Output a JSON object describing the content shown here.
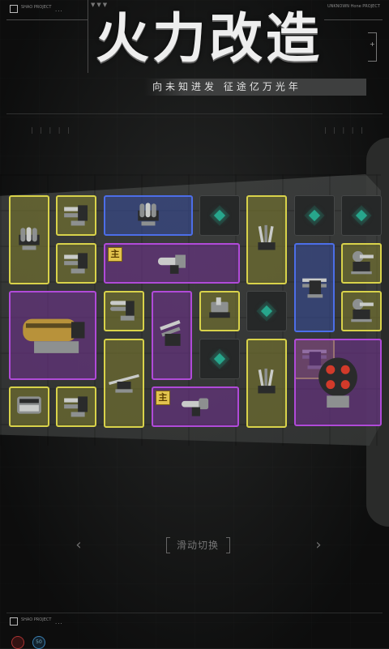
{
  "header": {
    "title": "火力改造",
    "subtitle": "向未知进发  征途亿万光年",
    "hud_tag_left": "!",
    "hud_tiny_left": "SHAO PROJECT",
    "hud_dots": "...",
    "hud_tiny_right": "UNKNOWN Hone PROJECT",
    "hud_plus": "+"
  },
  "deco": {
    "ticks_left": "|  |  |  |  |",
    "ticks_right": "|  |  |  |  |"
  },
  "grid": {
    "main_badge": "主",
    "slots": [
      {
        "name": "slot-rocket-pod",
        "color": "yellow",
        "weapon": "rocket-pod-icon"
      },
      {
        "name": "slot-twin-cannon-a",
        "color": "yellow",
        "weapon": "twin-cannon-icon"
      },
      {
        "name": "slot-rocket-pod-blue",
        "color": "blue",
        "weapon": "rocket-pod-icon"
      },
      {
        "name": "slot-empty-1",
        "color": "empty",
        "weapon": ""
      },
      {
        "name": "slot-missile-rack-a",
        "color": "yellow",
        "weapon": "missile-rack-icon"
      },
      {
        "name": "slot-empty-2",
        "color": "empty",
        "weapon": ""
      },
      {
        "name": "slot-empty-3",
        "color": "empty",
        "weapon": ""
      },
      {
        "name": "slot-twin-cannon-b",
        "color": "yellow",
        "weapon": "twin-cannon-icon"
      },
      {
        "name": "slot-main-gatling",
        "color": "purple",
        "weapon": "gatling-cannon-icon",
        "main": true
      },
      {
        "name": "slot-twin-turret-blue",
        "color": "blue",
        "weapon": "twin-turret-icon"
      },
      {
        "name": "slot-heavy-turret-a",
        "color": "yellow",
        "weapon": "heavy-turret-icon"
      },
      {
        "name": "slot-heavy-cannon",
        "color": "purple",
        "weapon": "heavy-cannon-icon"
      },
      {
        "name": "slot-twin-barrel",
        "color": "yellow",
        "weapon": "twin-barrel-icon"
      },
      {
        "name": "slot-artillery",
        "color": "purple",
        "weapon": "artillery-icon"
      },
      {
        "name": "slot-mortar",
        "color": "yellow",
        "weapon": "mortar-icon"
      },
      {
        "name": "slot-empty-4",
        "color": "empty",
        "weapon": ""
      },
      {
        "name": "slot-heavy-turret-b",
        "color": "yellow",
        "weapon": "heavy-turret-icon"
      },
      {
        "name": "slot-empty-5",
        "color": "empty",
        "weapon": ""
      },
      {
        "name": "slot-missile-rack-b",
        "color": "yellow",
        "weapon": "missile-rack-icon"
      },
      {
        "name": "slot-long-rifle",
        "color": "yellow",
        "weapon": "long-rifle-icon"
      },
      {
        "name": "slot-twin-turret-c",
        "color": "yellow",
        "weapon": "twin-turret-icon"
      },
      {
        "name": "slot-rotary-launcher",
        "color": "purple",
        "weapon": "rotary-launcher-icon"
      },
      {
        "name": "slot-engine-block",
        "color": "yellow",
        "weapon": "engine-block-icon"
      },
      {
        "name": "slot-twin-cannon-c",
        "color": "yellow",
        "weapon": "twin-cannon-icon"
      },
      {
        "name": "slot-main-railgun",
        "color": "purple",
        "weapon": "railgun-icon",
        "main": true
      }
    ]
  },
  "footer": {
    "swipe_label": "滑动切换",
    "prev_arrow": "‹",
    "next_arrow": "›",
    "hud_tag": "!",
    "hud_tiny": "SHAO PROJECT",
    "hud_dots": "...",
    "circle_1": "",
    "circle_2": "50"
  },
  "colors": {
    "yellow_border": "#d8d24a",
    "blue_border": "#4c6ee8",
    "purple_border": "#b04ad8",
    "empty_core": "#27a68c",
    "badge": "#e2c34e"
  }
}
